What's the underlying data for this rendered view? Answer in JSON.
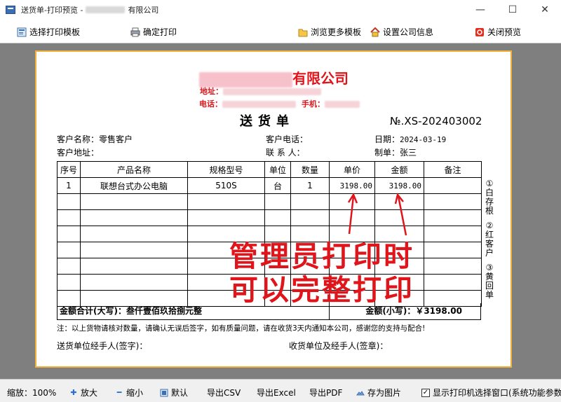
{
  "window": {
    "title_prefix": "送货单-打印预览 -",
    "title_suffix": "有限公司",
    "minimize": "—",
    "maximize": "☐",
    "close": "✕"
  },
  "toolbar": {
    "choose_template": "选择打印模板",
    "confirm_print": "确定打印",
    "browse_templates": "浏览更多模板",
    "company_settings": "设置公司信息",
    "close_preview": "关闭预览"
  },
  "document": {
    "company_suffix": "有限公司",
    "address_label": "地址：",
    "phone_label": "电话：",
    "mobile_label": "手机：",
    "title": "送货单",
    "number": "№.XS-202403002",
    "customer_name_label": "客户名称：",
    "customer_name": "零售客户",
    "customer_phone_label": "客户电话：",
    "date_label": "日期：",
    "date": "2024-03-19",
    "customer_address_label": "客户地址：",
    "contact_label": "联 系 人：",
    "maker_label": "制单：",
    "maker": "张三",
    "columns": [
      "序号",
      "产品名称",
      "规格型号",
      "单位",
      "数量",
      "单价",
      "金额",
      "备注"
    ],
    "row": {
      "index": "1",
      "product": "联想台式办公电脑",
      "spec": "510S",
      "unit": "台",
      "qty": "1",
      "price": "3198.00",
      "amount": "3198.00",
      "note": ""
    },
    "total_upper_label": "金额合计(大写)：",
    "total_upper": "叁仟壹佰玖拾捌元整",
    "total_lower_label": "金额(小写)：",
    "total_lower": "￥3198.00",
    "notice": "注：以上货物请核对数量，请确认无误后签字，如有质量问题，请在收货3天内通知本公司，感谢您的支持与配合!",
    "sender_sign": "送货单位经手人(签字)：",
    "receiver_sign": "收货单位及经手人(签章)：",
    "copies": [
      "①白存根",
      "②红客户",
      "③黄回单"
    ]
  },
  "annotation": {
    "line1": "管理员打印时",
    "line2": "可以完整打印"
  },
  "bottombar": {
    "zoom_label": "缩放：",
    "zoom_value": "100%",
    "zoom_in": "放大",
    "zoom_out": "缩小",
    "default": "默认",
    "export_csv": "导出CSV",
    "export_excel": "导出Excel",
    "export_pdf": "导出PDF",
    "save_image": "存为图片",
    "show_printer_dialog": "显示打印机选择窗口(系统功能参数"
  },
  "colors": {
    "accent_red": "#e0151b",
    "paper_border": "#f0b13c",
    "preview_bg": "#7f7f7f"
  }
}
